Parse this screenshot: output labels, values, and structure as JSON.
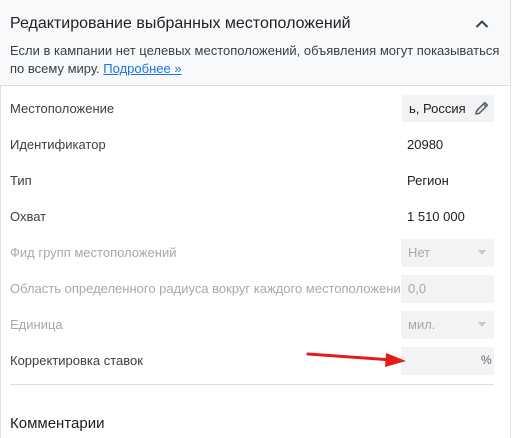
{
  "header": {
    "title": "Редактирование выбранных местоположений",
    "description": "Если в кампании нет целевых местоположений, объявления могут показываться по всему миру.",
    "link_label": "Подробнее »"
  },
  "rows": {
    "location": {
      "label": "Местоположение",
      "value": "ь, Россия"
    },
    "id": {
      "label": "Идентификатор",
      "value": "20980"
    },
    "type": {
      "label": "Тип",
      "value": "Регион"
    },
    "reach": {
      "label": "Охват",
      "value": "1 510 000"
    },
    "feed": {
      "label": "Фид групп местоположений",
      "value": "Нет"
    },
    "radius": {
      "label": "Область определенного радиуса вокруг каждого местоположения",
      "value": "0,0"
    },
    "unit": {
      "label": "Единица",
      "value": "мил."
    },
    "bid": {
      "label": "Корректировка ставок",
      "value": "",
      "suffix": "%"
    }
  },
  "comments": {
    "title": "Комментарии"
  },
  "icons": {
    "collapse": "chevron-up-icon",
    "edit": "pencil-icon",
    "annotation": "red-arrow"
  },
  "colors": {
    "link": "#1a73e8",
    "annotation_arrow": "#e21b1b"
  }
}
